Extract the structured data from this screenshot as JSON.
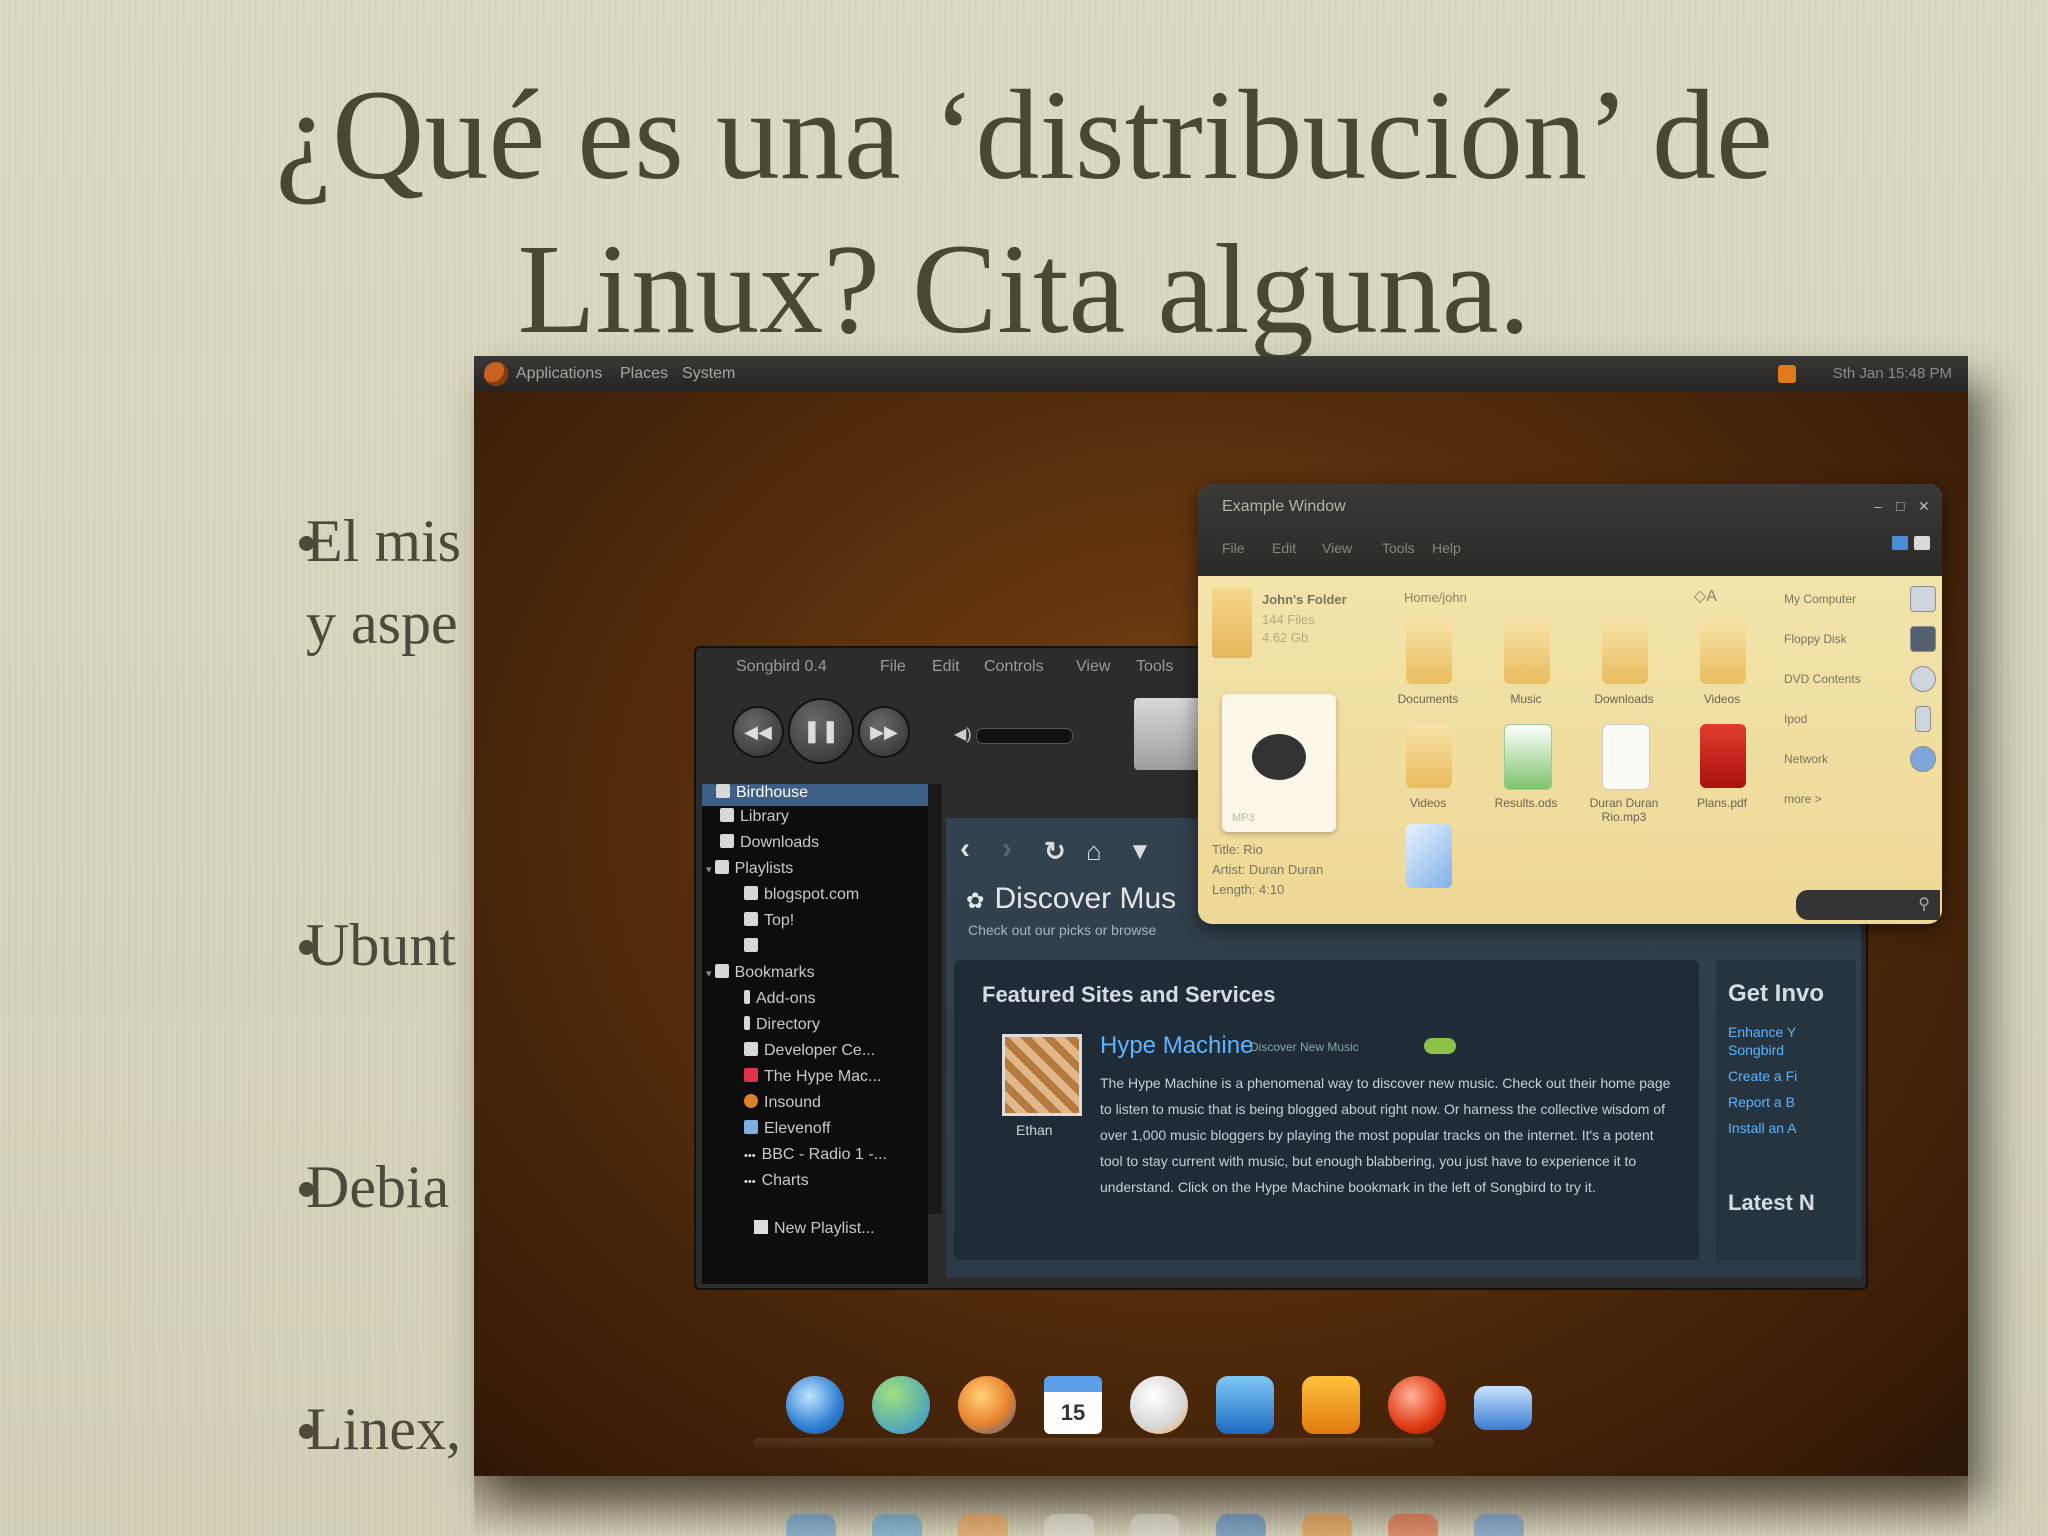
{
  "slide": {
    "title_line1": "¿Qué es una ‘distribución’ de",
    "title_line2": "Linux? Cita alguna.",
    "bullets": [
      {
        "line1": "El mis",
        "line2": "y aspe"
      },
      {
        "line1": "Ubunt"
      },
      {
        "line1": "Debia"
      },
      {
        "line1": "Linex,"
      }
    ]
  },
  "screenshot": {
    "topbar": {
      "menus": [
        "Applications",
        "Places",
        "System"
      ],
      "clock": "Sth Jan 15:48 PM"
    },
    "songbird": {
      "title": "Songbird 0.4",
      "menu": [
        "File",
        "Edit",
        "Controls",
        "View",
        "Tools"
      ],
      "sidebar": [
        "Birdhouse",
        "Library",
        "Downloads",
        "Playlists",
        "blogspot.com",
        "Top!",
        "",
        "Bookmarks",
        "Add-ons",
        "Directory",
        "Developer Ce...",
        "The Hype Mac...",
        "Insound",
        "Elevenoff",
        "BBC - Radio 1 -...",
        "Charts"
      ],
      "new_playlist": "New Playlist...",
      "discover": "Discover Mus",
      "discover_sub": "Check out our picks or browse",
      "featured_title": "Featured Sites and Services",
      "featured_name": "Hype Machine",
      "featured_tagline": "Discover New Music",
      "thumb_caption": "Ethan",
      "featured_body": "The Hype Machine is a phenomenal way to discover new music. Check out their home page to listen to music that is being blogged about right now. Or harness the collective wisdom of over 1,000 music bloggers by playing the most popular tracks on the internet. It's a potent tool to stay current with music, but enough blabbering, you just have to experience it to understand. Click on the Hype Machine bookmark in the left of Songbird to try it.",
      "right_heading": "Get Invo",
      "right_links": [
        "Enhance Y",
        "Songbird",
        "Create a Fi",
        "Report a B",
        "Install an A"
      ],
      "right_heading2": "Latest N"
    },
    "file_manager": {
      "title": "Example Window",
      "menu": [
        "File",
        "Edit",
        "View",
        "Tools",
        "Help"
      ],
      "folder_name": "John's Folder",
      "folder_info": [
        "144 Files",
        "4.62 Gb"
      ],
      "path": "Home/john",
      "file_meta": [
        "Title: Rio",
        "Artist: Duran Duran",
        "Length: 4:10"
      ],
      "art_label": "MP3",
      "icons": [
        "Documents",
        "Music",
        "Downloads",
        "Videos",
        "Videos",
        "Results.ods",
        "Duran Duran Rio.mp3",
        "Plans.pdf",
        ""
      ],
      "places": [
        "My Computer",
        "Floppy Disk",
        "DVD Contents",
        "Ipod",
        "Network",
        "more >"
      ]
    },
    "dock": [
      "dock-safari-icon",
      "dock-messenger-icon",
      "dock-firefox-icon",
      "dock-calendar-icon",
      "dock-itunes-icon",
      "dock-word-icon",
      "dock-powerpoint-icon",
      "dock-quicktime-icon",
      "dock-mail-icon"
    ],
    "calendar_day": "15"
  },
  "colors": {
    "title": "#4a4734",
    "desktop": "#5a300d",
    "accent_link": "#5fb4ff"
  }
}
